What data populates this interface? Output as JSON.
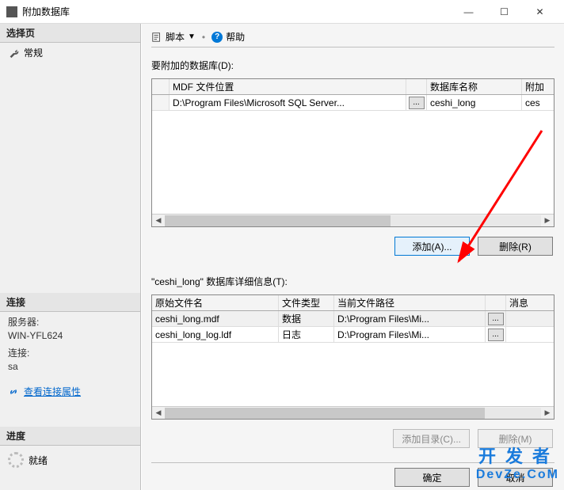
{
  "window": {
    "title": "附加数据库"
  },
  "sidebar": {
    "select_page": "选择页",
    "general": "常规",
    "connection_header": "连接",
    "server_label": "服务器:",
    "server_value": "WIN-YFL624",
    "conn_label": "连接:",
    "conn_value": "sa",
    "view_conn_props": "查看连接属性",
    "progress_header": "进度",
    "progress_status": "就绪"
  },
  "toolbar": {
    "script": "脚本",
    "help": "帮助"
  },
  "attach": {
    "label": "要附加的数据库(D):",
    "headers": {
      "mdf": "MDF 文件位置",
      "dbname": "数据库名称",
      "attach": "附加"
    },
    "rows": [
      {
        "path": "D:\\Program Files\\Microsoft SQL Server...",
        "dbname": "ceshi_long",
        "attach": "ces"
      }
    ],
    "add_btn": "添加(A)...",
    "remove_btn": "删除(R)"
  },
  "details": {
    "label": "\"ceshi_long\" 数据库详细信息(T):",
    "headers": {
      "orig": "原始文件名",
      "ftype": "文件类型",
      "curpath": "当前文件路径",
      "msg": "消息"
    },
    "rows": [
      {
        "orig": "ceshi_long.mdf",
        "ftype": "数据",
        "curpath": "D:\\Program Files\\Mi...",
        "msg": ""
      },
      {
        "orig": "ceshi_long_log.ldf",
        "ftype": "日志",
        "curpath": "D:\\Program Files\\Mi...",
        "msg": ""
      }
    ],
    "add_dir_btn": "添加目录(C)...",
    "remove_btn": "删除(M)"
  },
  "footer": {
    "ok": "确定",
    "cancel": "取消"
  },
  "watermark": {
    "cn": "开发者",
    "en": "DevZe.CoM"
  }
}
